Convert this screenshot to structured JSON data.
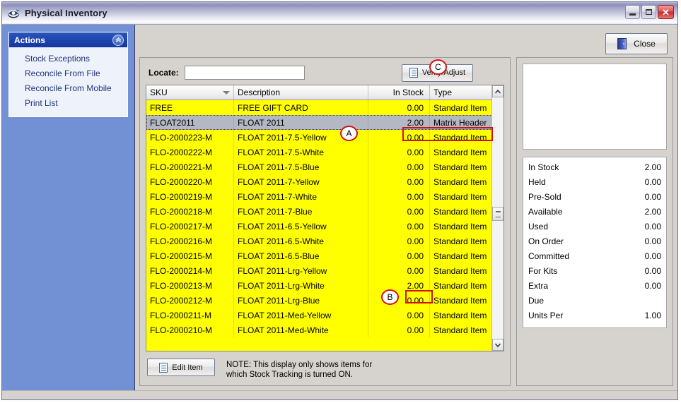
{
  "window": {
    "title": "Physical Inventory",
    "icon": "app-icon",
    "buttons": {
      "minimize": "_",
      "maximize": "□",
      "close": "✕"
    }
  },
  "sidebar": {
    "panel_title": "Actions",
    "collapse_icon": "chevron-up-icon",
    "items": [
      {
        "label": "Stock Exceptions"
      },
      {
        "label": "Reconcile From File"
      },
      {
        "label": "Reconcile From Mobile"
      },
      {
        "label": "Print List"
      }
    ]
  },
  "toolbar": {
    "close_label": "Close",
    "close_icon": "door-exit-icon"
  },
  "locate": {
    "label": "Locate:",
    "value": "",
    "placeholder": ""
  },
  "verify": {
    "label": "Verify/Adjust",
    "icon": "document-icon"
  },
  "grid": {
    "columns": [
      "SKU",
      "Description",
      "In Stock",
      "Type"
    ],
    "sort_indicator_column": "SKU",
    "rows": [
      {
        "sku": "FREE",
        "description": "FREE GIFT CARD",
        "in_stock": "0.00",
        "type": "Standard Item",
        "selected": false
      },
      {
        "sku": "FLOAT2011",
        "description": "FLOAT 2011",
        "in_stock": "2.00",
        "type": "Matrix Header",
        "selected": true
      },
      {
        "sku": "FLO-2000223-M",
        "description": "FLOAT 2011-7.5-Yellow",
        "in_stock": "0.00",
        "type": "Standard Item",
        "selected": false
      },
      {
        "sku": "FLO-2000222-M",
        "description": "FLOAT 2011-7.5-White",
        "in_stock": "0.00",
        "type": "Standard Item",
        "selected": false
      },
      {
        "sku": "FLO-2000221-M",
        "description": "FLOAT 2011-7.5-Blue",
        "in_stock": "0.00",
        "type": "Standard Item",
        "selected": false
      },
      {
        "sku": "FLO-2000220-M",
        "description": "FLOAT 2011-7-Yellow",
        "in_stock": "0.00",
        "type": "Standard Item",
        "selected": false
      },
      {
        "sku": "FLO-2000219-M",
        "description": "FLOAT 2011-7-White",
        "in_stock": "0.00",
        "type": "Standard Item",
        "selected": false
      },
      {
        "sku": "FLO-2000218-M",
        "description": "FLOAT 2011-7-Blue",
        "in_stock": "0.00",
        "type": "Standard Item",
        "selected": false
      },
      {
        "sku": "FLO-2000217-M",
        "description": "FLOAT 2011-6.5-Yellow",
        "in_stock": "0.00",
        "type": "Standard Item",
        "selected": false
      },
      {
        "sku": "FLO-2000216-M",
        "description": "FLOAT 2011-6.5-White",
        "in_stock": "0.00",
        "type": "Standard Item",
        "selected": false
      },
      {
        "sku": "FLO-2000215-M",
        "description": "FLOAT 2011-6.5-Blue",
        "in_stock": "0.00",
        "type": "Standard Item",
        "selected": false
      },
      {
        "sku": "FLO-2000214-M",
        "description": "FLOAT 2011-Lrg-Yellow",
        "in_stock": "0.00",
        "type": "Standard Item",
        "selected": false
      },
      {
        "sku": "FLO-2000213-M",
        "description": "FLOAT 2011-Lrg-White",
        "in_stock": "2.00",
        "type": "Standard Item",
        "selected": false
      },
      {
        "sku": "FLO-2000212-M",
        "description": "FLOAT 2011-Lrg-Blue",
        "in_stock": "0.00",
        "type": "Standard Item",
        "selected": false
      },
      {
        "sku": "FLO-2000211-M",
        "description": "FLOAT 2011-Med-Yellow",
        "in_stock": "0.00",
        "type": "Standard Item",
        "selected": false
      },
      {
        "sku": "FLO-2000210-M",
        "description": "FLOAT 2011-Med-White",
        "in_stock": "0.00",
        "type": "Standard Item",
        "selected": false
      }
    ]
  },
  "footer": {
    "edit_item_label": "Edit Item",
    "edit_item_icon": "document-icon",
    "note_line1": "NOTE: This display only shows items for",
    "note_line2": "which Stock Tracking is turned ON."
  },
  "stats": [
    {
      "label": "In Stock",
      "value": "2.00"
    },
    {
      "label": "Held",
      "value": "0.00"
    },
    {
      "label": "Pre-Sold",
      "value": "0.00"
    },
    {
      "label": "Available",
      "value": "2.00"
    },
    {
      "label": "Used",
      "value": "0.00"
    },
    {
      "label": "On Order",
      "value": "0.00"
    },
    {
      "label": "Committed",
      "value": "0.00"
    },
    {
      "label": "For Kits",
      "value": "0.00"
    },
    {
      "label": "Extra",
      "value": "0.00"
    },
    {
      "label": "Due",
      "value": ""
    },
    {
      "label": "Units Per",
      "value": "1.00"
    }
  ],
  "annotations": [
    {
      "id": "A",
      "label": "A"
    },
    {
      "id": "B",
      "label": "B"
    },
    {
      "id": "C",
      "label": "C"
    }
  ],
  "colors": {
    "grid_highlight": "#ffff00",
    "grid_selected_row": "#b4b8c4",
    "annotation_red": "#d01010",
    "sidebar_blue": "#7290d4",
    "panel_header_blue": "#1c44a8"
  }
}
